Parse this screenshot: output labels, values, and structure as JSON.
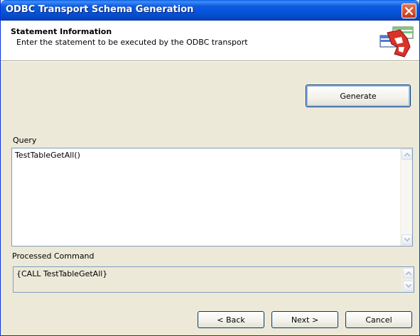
{
  "window": {
    "title": "ODBC Transport Schema Generation"
  },
  "header": {
    "title": "Statement Information",
    "subtitle": "Enter the statement to be executed by the ODBC transport"
  },
  "buttons": {
    "generate": "Generate",
    "back": "< Back",
    "next": "Next >",
    "cancel": "Cancel"
  },
  "query": {
    "label": "Query",
    "value": "TestTableGetAll()"
  },
  "processed": {
    "label": "Processed Command",
    "value": "{CALL TestTableGetAll}"
  },
  "icons": {
    "close": "close-icon",
    "logo": "wizard-logo-icon",
    "scroll_up": "scroll-up-arrow-icon",
    "scroll_down": "scroll-down-arrow-icon"
  },
  "colors": {
    "titlebar": "#0553D9",
    "dialog_bg": "#ECE9D8",
    "close_button": "#D2502E",
    "border_blue": "#003C74"
  }
}
